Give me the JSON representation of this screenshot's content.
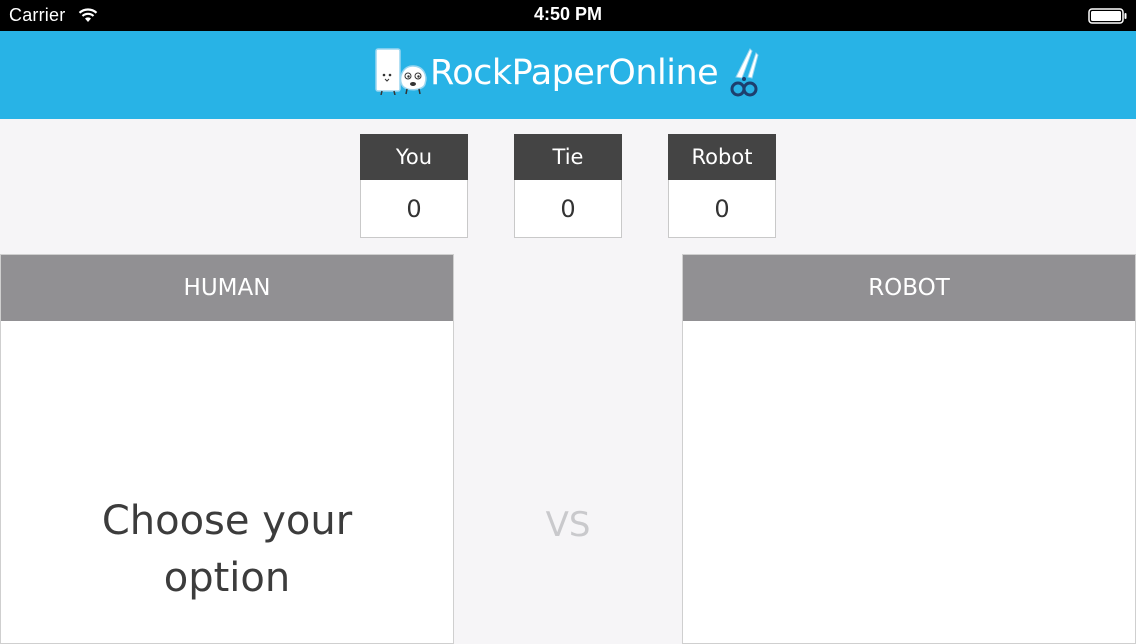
{
  "status_bar": {
    "carrier": "Carrier",
    "time": "4:50 PM"
  },
  "header": {
    "brand": "RockPaperOnline",
    "background": "#28b3e6"
  },
  "scoreboard": [
    {
      "label": "You",
      "value": "0"
    },
    {
      "label": "Tie",
      "value": "0"
    },
    {
      "label": "Robot",
      "value": "0"
    }
  ],
  "human_panel": {
    "title": "HUMAN",
    "prompt": "Choose your option"
  },
  "vs_label": "VS",
  "robot_panel": {
    "title": "ROBOT"
  },
  "icons": [
    "wifi-icon",
    "battery-icon",
    "logo-paper-icon",
    "logo-rock-icon",
    "logo-scissors-icon"
  ]
}
